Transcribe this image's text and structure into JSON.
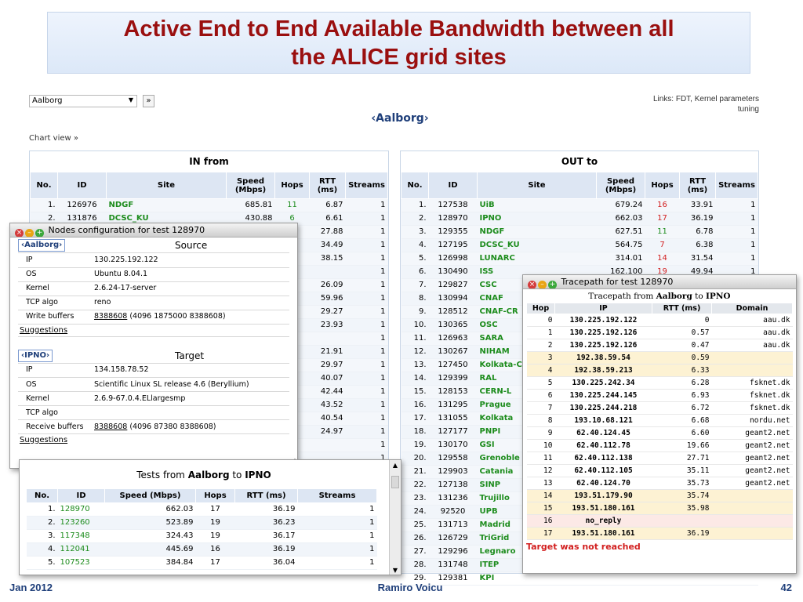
{
  "slide": {
    "title_line1": "Active End to End Available Bandwidth between all",
    "title_line2": "the ALICE grid sites",
    "footer_left": "Jan 2012",
    "footer_center": "Ramiro Voicu",
    "footer_right": "42"
  },
  "colors": {
    "title": "#9a0f0f",
    "site_link": "#1d8c1d",
    "hops_alert": "#d21f1f",
    "target_fail": "#d21f1f"
  },
  "controls": {
    "site_select": "Aalborg",
    "go_label": "»",
    "links_line1": "Links: FDT, Kernel parameters",
    "links_line2": "tuning",
    "selected_site": "‹Aalborg›",
    "chart_view": "Chart view »"
  },
  "in_table": {
    "title": "IN from",
    "headers": [
      "No.",
      "ID",
      "Site",
      "Speed (Mbps)",
      "Hops",
      "RTT (ms)",
      "Streams"
    ],
    "rows": [
      [
        "1.",
        "126976",
        "NDGF",
        "685.81",
        "11",
        "6.87",
        "1"
      ],
      [
        "2.",
        "131876",
        "DCSC_KU",
        "430.88",
        "6",
        "6.61",
        "1"
      ],
      [
        "",
        "",
        "",
        "",
        "",
        "27.88",
        "1"
      ],
      [
        "",
        "",
        "",
        "",
        "",
        "34.49",
        "1"
      ],
      [
        "",
        "",
        "",
        "",
        "",
        "38.15",
        "1"
      ],
      [
        "",
        "",
        "",
        "",
        "",
        "",
        "1"
      ],
      [
        "",
        "",
        "",
        "",
        "",
        "26.09",
        "1"
      ],
      [
        "",
        "",
        "",
        "",
        "",
        "59.96",
        "1"
      ],
      [
        "",
        "",
        "",
        "",
        "",
        "29.27",
        "1"
      ],
      [
        "",
        "",
        "",
        "",
        "",
        "23.93",
        "1"
      ],
      [
        "",
        "",
        "",
        "",
        "",
        "",
        "1"
      ],
      [
        "",
        "",
        "",
        "",
        "",
        "21.91",
        "1"
      ],
      [
        "",
        "",
        "",
        "",
        "",
        "29.97",
        "1"
      ],
      [
        "",
        "",
        "",
        "",
        "",
        "40.07",
        "1"
      ],
      [
        "",
        "",
        "",
        "",
        "",
        "42.44",
        "1"
      ],
      [
        "",
        "",
        "",
        "",
        "",
        "43.52",
        "1"
      ],
      [
        "",
        "",
        "",
        "",
        "",
        "40.54",
        "1"
      ],
      [
        "",
        "",
        "",
        "",
        "",
        "24.97",
        "1"
      ],
      [
        "",
        "",
        "",
        "",
        "",
        "",
        "1"
      ],
      [
        "",
        "",
        "",
        "",
        "",
        "",
        "1"
      ]
    ]
  },
  "out_table": {
    "title": "OUT to",
    "headers": [
      "No.",
      "ID",
      "Site",
      "Speed (Mbps)",
      "Hops",
      "RTT (ms)",
      "Streams"
    ],
    "rows": [
      [
        "1.",
        "127538",
        "UiB",
        "679.24",
        "16",
        "33.91",
        "1"
      ],
      [
        "2.",
        "128970",
        "IPNO",
        "662.03",
        "17",
        "36.19",
        "1"
      ],
      [
        "3.",
        "129355",
        "NDGF",
        "627.51",
        "11",
        "6.78",
        "1"
      ],
      [
        "4.",
        "127195",
        "DCSC_KU",
        "564.75",
        "7",
        "6.38",
        "1"
      ],
      [
        "5.",
        "126998",
        "LUNARC",
        "314.01",
        "14",
        "31.54",
        "1"
      ],
      [
        "6.",
        "130490",
        "ISS",
        "162.100",
        "19",
        "49.94",
        "1"
      ],
      [
        "7.",
        "129827",
        "CSC",
        "",
        "",
        "",
        ""
      ],
      [
        "8.",
        "130994",
        "CNAF",
        "",
        "",
        "",
        ""
      ],
      [
        "9.",
        "128512",
        "CNAF-CR",
        "",
        "",
        "",
        ""
      ],
      [
        "10.",
        "130365",
        "OSC",
        "",
        "",
        "",
        ""
      ],
      [
        "11.",
        "126963",
        "SARA",
        "",
        "",
        "",
        ""
      ],
      [
        "12.",
        "130267",
        "NIHAM",
        "",
        "",
        "",
        ""
      ],
      [
        "13.",
        "127450",
        "Kolkata-C",
        "",
        "",
        "",
        ""
      ],
      [
        "14.",
        "129399",
        "RAL",
        "",
        "",
        "",
        ""
      ],
      [
        "15.",
        "128153",
        "CERN-L",
        "",
        "",
        "",
        ""
      ],
      [
        "16.",
        "131295",
        "Prague",
        "",
        "",
        "",
        ""
      ],
      [
        "17.",
        "131055",
        "Kolkata",
        "",
        "",
        "",
        ""
      ],
      [
        "18.",
        "127177",
        "PNPI",
        "",
        "",
        "",
        ""
      ],
      [
        "19.",
        "130170",
        "GSI",
        "",
        "",
        "",
        ""
      ],
      [
        "20.",
        "129558",
        "Grenoble",
        "",
        "",
        "",
        ""
      ],
      [
        "21.",
        "129903",
        "Catania",
        "",
        "",
        "",
        ""
      ],
      [
        "22.",
        "127138",
        "SINP",
        "",
        "",
        "",
        ""
      ],
      [
        "23.",
        "131236",
        "Trujillo",
        "",
        "",
        "",
        ""
      ],
      [
        "24.",
        "92520",
        "UPB",
        "",
        "",
        "",
        ""
      ],
      [
        "25.",
        "131713",
        "Madrid",
        "",
        "",
        "",
        ""
      ],
      [
        "26.",
        "126729",
        "TriGrid",
        "",
        "",
        "",
        ""
      ],
      [
        "27.",
        "129296",
        "Legnaro",
        "",
        "",
        "",
        ""
      ],
      [
        "28.",
        "131748",
        "ITEP",
        "",
        "",
        "",
        ""
      ],
      [
        "29.",
        "129381",
        "KPI",
        "",
        "",
        "",
        ""
      ]
    ]
  },
  "nodes_window": {
    "title": "Nodes configuration for test 128970",
    "source_heading": "Source",
    "source_label": "‹Aalborg›",
    "source": [
      {
        "k": "IP",
        "v": "130.225.192.122"
      },
      {
        "k": "OS",
        "v": "Ubuntu 8.04.1"
      },
      {
        "k": "Kernel",
        "v": "2.6.24-17-server"
      },
      {
        "k": "TCP algo",
        "v": "reno"
      },
      {
        "k": "Write buffers",
        "v_link": "8388608",
        "v": " (4096 1875000 8388608)"
      }
    ],
    "suggestions": "Suggestions",
    "target_heading": "Target",
    "target_label": "‹IPNO›",
    "target": [
      {
        "k": "IP",
        "v": "134.158.78.52"
      },
      {
        "k": "OS",
        "v": "Scientific Linux SL release 4.6 (Beryllium)"
      },
      {
        "k": "Kernel",
        "v": "2.6.9-67.0.4.ELlargesmp"
      },
      {
        "k": "TCP algo",
        "v": ""
      },
      {
        "k": "Receive buffers",
        "v_link": "8388608",
        "v": " (4096 87380 8388608)"
      }
    ]
  },
  "tests_window": {
    "title_pre": "Tests from ",
    "title_from": "Aalborg",
    "title_mid": " to ",
    "title_to": "IPNO",
    "headers": [
      "No.",
      "ID",
      "Speed (Mbps)",
      "Hops",
      "RTT (ms)",
      "Streams"
    ],
    "rows": [
      [
        "1.",
        "128970",
        "662.03",
        "17",
        "36.19",
        "1"
      ],
      [
        "2.",
        "123260",
        "523.89",
        "19",
        "36.23",
        "1"
      ],
      [
        "3.",
        "117348",
        "324.43",
        "19",
        "36.17",
        "1"
      ],
      [
        "4.",
        "112041",
        "445.69",
        "16",
        "36.19",
        "1"
      ],
      [
        "5.",
        "107523",
        "384.84",
        "17",
        "36.04",
        "1"
      ]
    ]
  },
  "tracepath_window": {
    "title": "Tracepath for test 128970",
    "caption_pre": "Tracepath from ",
    "caption_from": "Aalborg",
    "caption_mid": " to ",
    "caption_to": "IPNO",
    "headers": [
      "Hop",
      "IP",
      "RTT (ms)",
      "Domain"
    ],
    "rows": [
      [
        "0",
        "130.225.192.122",
        "0",
        "aau.dk"
      ],
      [
        "1",
        "130.225.192.126",
        "0.57",
        "aau.dk"
      ],
      [
        "2",
        "130.225.192.126",
        "0.47",
        "aau.dk"
      ],
      [
        "3",
        "192.38.59.54",
        "0.59",
        ""
      ],
      [
        "4",
        "192.38.59.213",
        "6.33",
        ""
      ],
      [
        "5",
        "130.225.242.34",
        "6.28",
        "fsknet.dk"
      ],
      [
        "6",
        "130.225.244.145",
        "6.93",
        "fsknet.dk"
      ],
      [
        "7",
        "130.225.244.218",
        "6.72",
        "fsknet.dk"
      ],
      [
        "8",
        "193.10.68.121",
        "6.68",
        "nordu.net"
      ],
      [
        "9",
        "62.40.124.45",
        "6.60",
        "geant2.net"
      ],
      [
        "10",
        "62.40.112.78",
        "19.66",
        "geant2.net"
      ],
      [
        "11",
        "62.40.112.138",
        "27.71",
        "geant2.net"
      ],
      [
        "12",
        "62.40.112.105",
        "35.11",
        "geant2.net"
      ],
      [
        "13",
        "62.40.124.70",
        "35.73",
        "geant2.net"
      ],
      [
        "14",
        "193.51.179.90",
        "35.74",
        ""
      ],
      [
        "15",
        "193.51.180.161",
        "35.98",
        ""
      ],
      [
        "16",
        "no_reply",
        "",
        ""
      ],
      [
        "17",
        "193.51.180.161",
        "36.19",
        ""
      ]
    ],
    "status": "Target was not reached"
  }
}
